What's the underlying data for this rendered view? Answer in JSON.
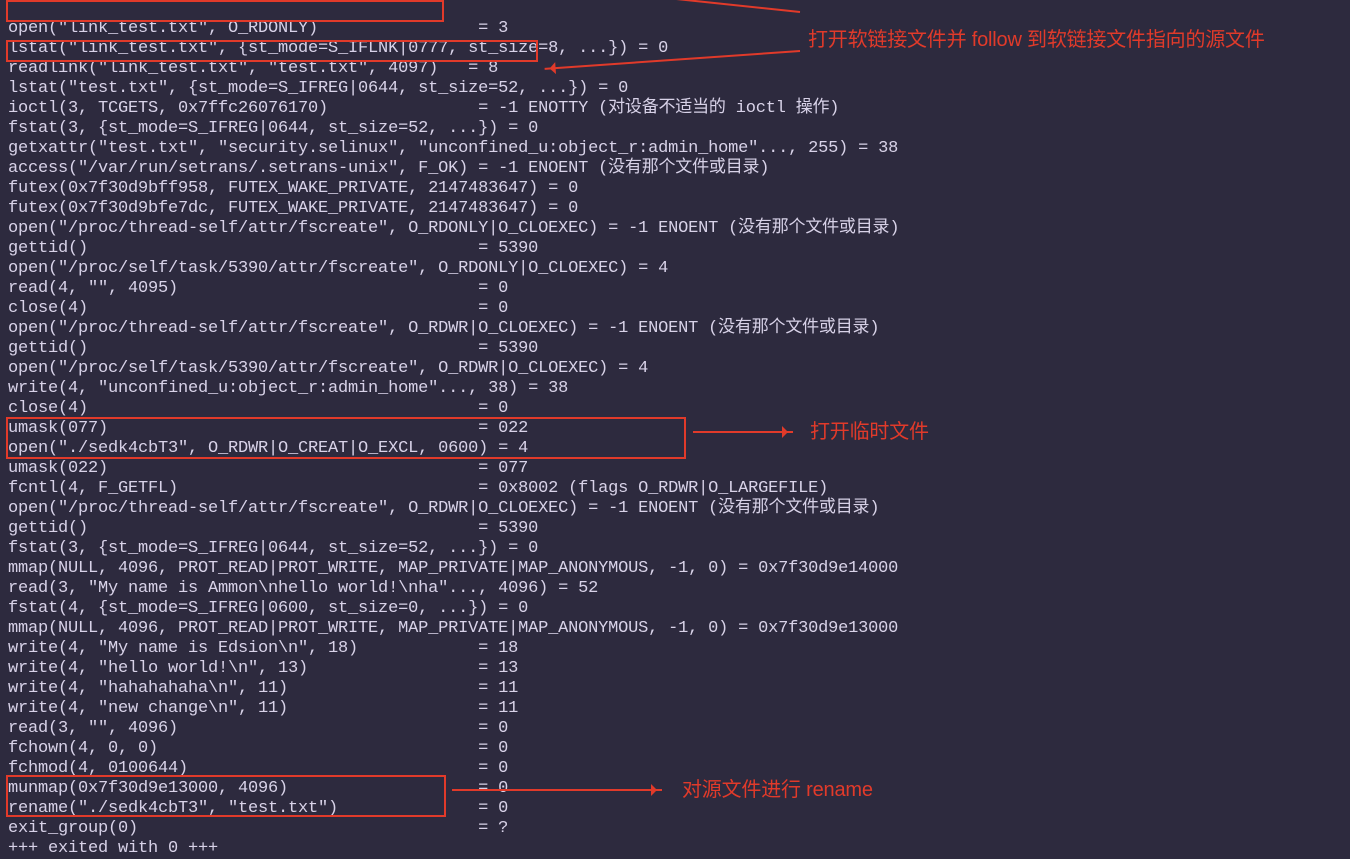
{
  "colors": {
    "bg": "#2d2a3e",
    "fg": "#d8d2e8",
    "annot": "#e13a2a"
  },
  "terminal": {
    "lines": [
      "open(\"link_test.txt\", O_RDONLY)                = 3",
      "lstat(\"link_test.txt\", {st_mode=S_IFLNK|0777, st_size=8, ...}) = 0",
      "readlink(\"link_test.txt\", \"test.txt\", 4097)   = 8",
      "lstat(\"test.txt\", {st_mode=S_IFREG|0644, st_size=52, ...}) = 0",
      "ioctl(3, TCGETS, 0x7ffc26076170)               = -1 ENOTTY (对设备不适当的 ioctl 操作)",
      "fstat(3, {st_mode=S_IFREG|0644, st_size=52, ...}) = 0",
      "getxattr(\"test.txt\", \"security.selinux\", \"unconfined_u:object_r:admin_home\"..., 255) = 38",
      "access(\"/var/run/setrans/.setrans-unix\", F_OK) = -1 ENOENT (没有那个文件或目录)",
      "futex(0x7f30d9bff958, FUTEX_WAKE_PRIVATE, 2147483647) = 0",
      "futex(0x7f30d9bfe7dc, FUTEX_WAKE_PRIVATE, 2147483647) = 0",
      "open(\"/proc/thread-self/attr/fscreate\", O_RDONLY|O_CLOEXEC) = -1 ENOENT (没有那个文件或目录)",
      "gettid()                                       = 5390",
      "open(\"/proc/self/task/5390/attr/fscreate\", O_RDONLY|O_CLOEXEC) = 4",
      "read(4, \"\", 4095)                              = 0",
      "close(4)                                       = 0",
      "open(\"/proc/thread-self/attr/fscreate\", O_RDWR|O_CLOEXEC) = -1 ENOENT (没有那个文件或目录)",
      "gettid()                                       = 5390",
      "open(\"/proc/self/task/5390/attr/fscreate\", O_RDWR|O_CLOEXEC) = 4",
      "write(4, \"unconfined_u:object_r:admin_home\"..., 38) = 38",
      "close(4)                                       = 0",
      "umask(077)                                     = 022",
      "open(\"./sedk4cbT3\", O_RDWR|O_CREAT|O_EXCL, 0600) = 4",
      "umask(022)                                     = 077",
      "fcntl(4, F_GETFL)                              = 0x8002 (flags O_RDWR|O_LARGEFILE)",
      "open(\"/proc/thread-self/attr/fscreate\", O_RDWR|O_CLOEXEC) = -1 ENOENT (没有那个文件或目录)",
      "gettid()                                       = 5390",
      "fstat(3, {st_mode=S_IFREG|0644, st_size=52, ...}) = 0",
      "mmap(NULL, 4096, PROT_READ|PROT_WRITE, MAP_PRIVATE|MAP_ANONYMOUS, -1, 0) = 0x7f30d9e14000",
      "read(3, \"My name is Ammon\\nhello world!\\nha\"..., 4096) = 52",
      "fstat(4, {st_mode=S_IFREG|0600, st_size=0, ...}) = 0",
      "mmap(NULL, 4096, PROT_READ|PROT_WRITE, MAP_PRIVATE|MAP_ANONYMOUS, -1, 0) = 0x7f30d9e13000",
      "write(4, \"My name is Edsion\\n\", 18)            = 18",
      "write(4, \"hello world!\\n\", 13)                 = 13",
      "write(4, \"hahahahaha\\n\", 11)                   = 11",
      "write(4, \"new change\\n\", 11)                   = 11",
      "read(3, \"\", 4096)                              = 0",
      "fchown(4, 0, 0)                                = 0",
      "fchmod(4, 0100644)                             = 0",
      "munmap(0x7f30d9e13000, 4096)                   = 0",
      "rename(\"./sedk4cbT3\", \"test.txt\")              = 0",
      "exit_group(0)                                  = ?",
      "+++ exited with 0 +++"
    ]
  },
  "annotations": {
    "a1": "打开软链接文件并 follow 到软链接文件指向的源文件",
    "a2": "打开临时文件",
    "a3": "对源文件进行 rename"
  }
}
